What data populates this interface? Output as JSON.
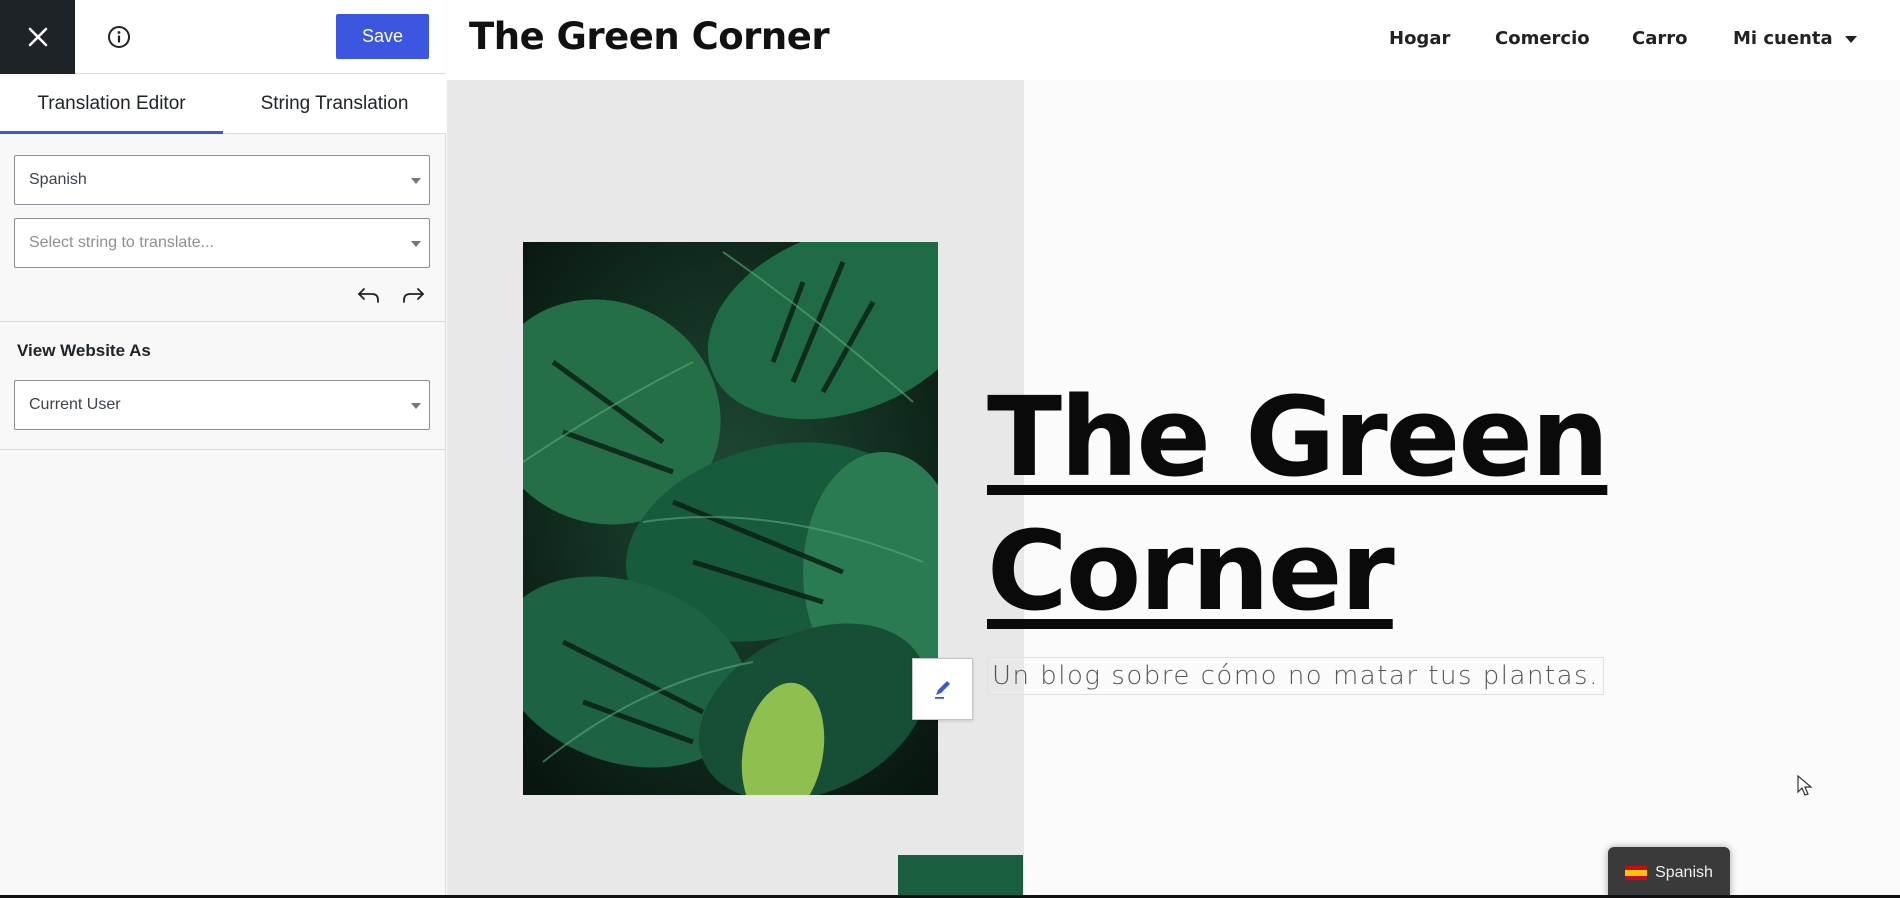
{
  "editor": {
    "close_icon": "close-icon",
    "info_icon": "info-icon",
    "save_label": "Save",
    "tabs": [
      {
        "label": "Translation Editor",
        "active": true
      },
      {
        "label": "String Translation",
        "active": false
      }
    ],
    "language_select": {
      "value": "Spanish"
    },
    "string_select": {
      "placeholder": "Select string to translate..."
    },
    "undo_icon": "undo-icon",
    "redo_icon": "redo-icon",
    "view_as": {
      "label": "View Website As",
      "value": "Current User"
    },
    "accent_color": "#3c56e0"
  },
  "site": {
    "logo": "The Green Corner",
    "nav": [
      {
        "label": "Hogar"
      },
      {
        "label": "Comercio"
      },
      {
        "label": "Carro"
      },
      {
        "label": "Mi cuenta",
        "has_dropdown": true
      }
    ],
    "hero": {
      "title_line1": "The Green",
      "title_line2": "Corner",
      "tagline": "Un blog sobre cómo no matar tus plantas."
    },
    "edit_icon": "pencil-icon",
    "language_switcher": {
      "label": "Spanish",
      "flag_icon": "spain-flag-icon"
    },
    "brand_green": "#1b5e3f"
  }
}
